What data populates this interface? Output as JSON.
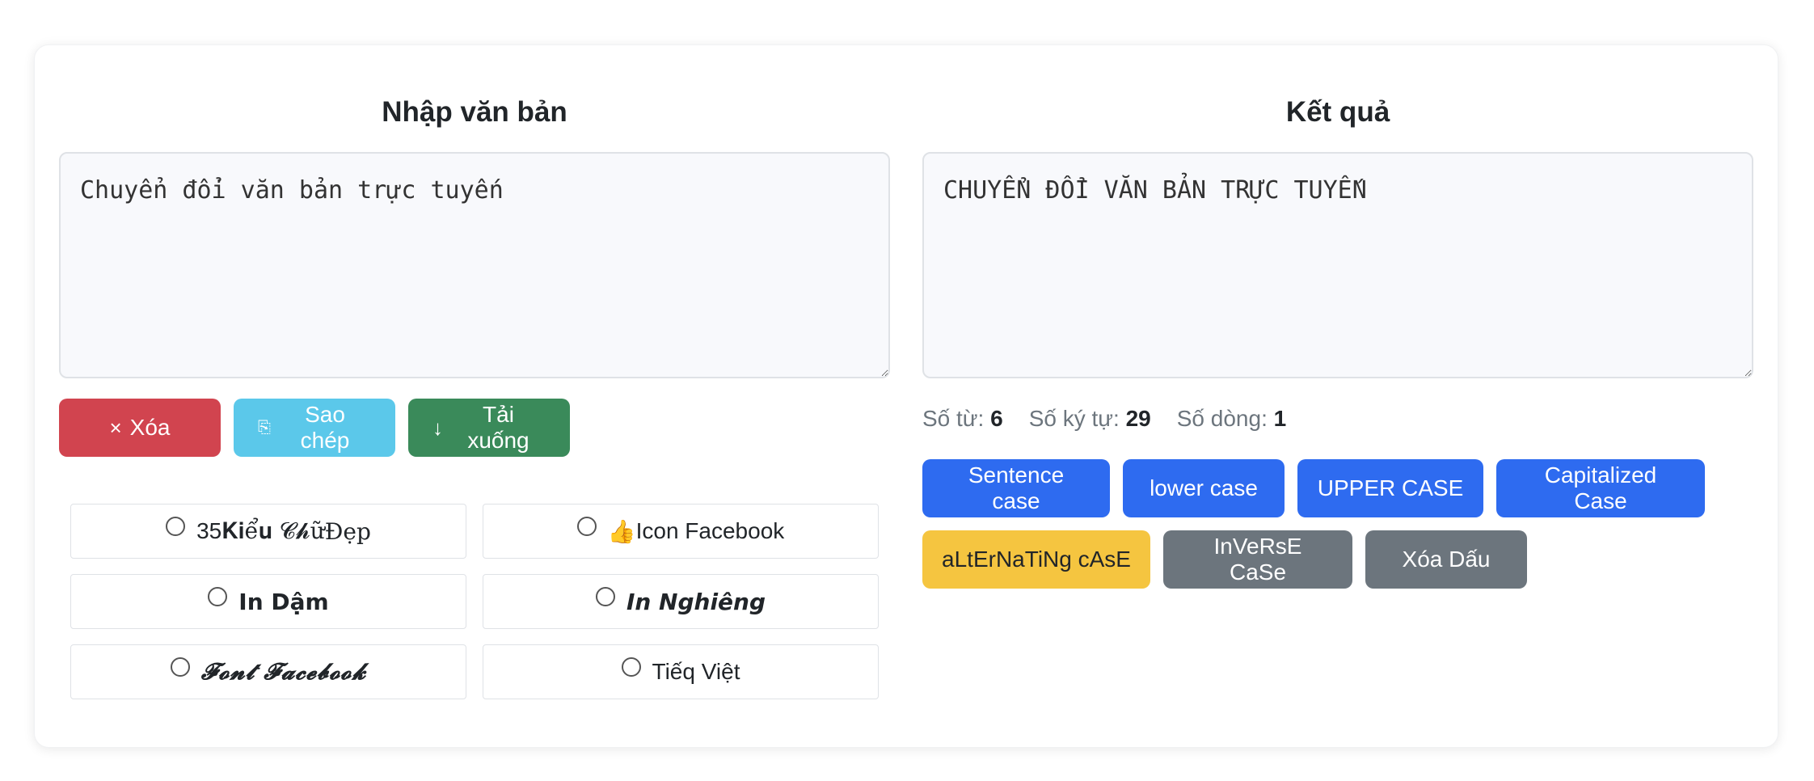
{
  "input_panel": {
    "title": "Nhập văn bản",
    "text": "Chuyển đổi văn bản trực tuyến",
    "buttons": {
      "clear": "Xóa",
      "copy": "Sao chép",
      "download": "Tải xuống"
    },
    "options": [
      {
        "pre": "35 ",
        "styled": "𝐊𝐢ể𝐮 𝓒𝓱ữ",
        "post": " Đẹp"
      },
      {
        "pre": "👍 ",
        "styled": "",
        "post": "Icon Facebook"
      },
      {
        "pre": "",
        "styled": "In Dậm",
        "post": ""
      },
      {
        "pre": "",
        "styled": "In Nghiêng",
        "post": ""
      },
      {
        "pre": "",
        "styled": "𝓕𝓸𝓷𝓽 𝓕𝓪𝓬𝓮𝓫𝓸𝓸𝓴",
        "post": ""
      },
      {
        "pre": "",
        "styled": "",
        "post": "Tiếq Việt"
      }
    ]
  },
  "output_panel": {
    "title": "Kết quả",
    "text": "CHUYỂN ĐỔI VĂN BẢN TRỰC TUYẾN",
    "stats": {
      "words_label": "Số từ:",
      "words": "6",
      "chars_label": "Số ký tự:",
      "chars": "29",
      "lines_label": "Số dòng:",
      "lines": "1"
    },
    "case_buttons": [
      {
        "label": "Sentence case",
        "color": "#2e6bf0"
      },
      {
        "label": "lower case",
        "color": "#2e6bf0"
      },
      {
        "label": "UPPER CASE",
        "color": "#2e6bf0"
      },
      {
        "label": "Capitalized Case",
        "color": "#2e6bf0"
      },
      {
        "label": "aLtErNaTiNg cAsE",
        "color": "#f5c540"
      },
      {
        "label": "InVeRsE CaSe",
        "color": "#6c757d"
      },
      {
        "label": "Xóa Dấu",
        "color": "#6c757d"
      }
    ]
  },
  "icons": {
    "clear": "×",
    "copy": "⎘",
    "download": "↓"
  },
  "colors": {
    "danger": "#d1444f",
    "info": "#5bc8ea",
    "success": "#3a8a5a",
    "primary": "#2e6bf0",
    "warning": "#f5c540",
    "secondary": "#6c757d"
  }
}
